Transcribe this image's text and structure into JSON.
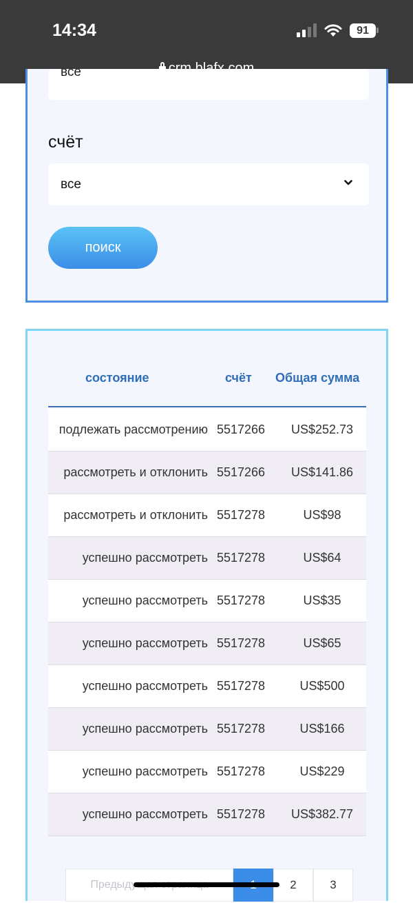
{
  "status_bar": {
    "time": "14:34",
    "battery": "91",
    "url": "crm.blafx.com"
  },
  "filter": {
    "prev_select_value": "все",
    "account_label": "счёт",
    "account_value": "все",
    "search_label": "поиск"
  },
  "table": {
    "headers": {
      "state": "состояние",
      "account": "счёт",
      "total": "Общая сумма"
    },
    "rows": [
      {
        "state": "подлежать рассмотрению",
        "account": "5517266",
        "total": "US$252.73"
      },
      {
        "state": "рассмотреть и отклонить",
        "account": "5517266",
        "total": "US$141.86"
      },
      {
        "state": "рассмотреть и отклонить",
        "account": "5517278",
        "total": "US$98"
      },
      {
        "state": "успешно рассмотреть",
        "account": "5517278",
        "total": "US$64"
      },
      {
        "state": "успешно рассмотреть",
        "account": "5517278",
        "total": "US$35"
      },
      {
        "state": "успешно рассмотреть",
        "account": "5517278",
        "total": "US$65"
      },
      {
        "state": "успешно рассмотреть",
        "account": "5517278",
        "total": "US$500"
      },
      {
        "state": "успешно рассмотреть",
        "account": "5517278",
        "total": "US$166"
      },
      {
        "state": "успешно рассмотреть",
        "account": "5517278",
        "total": "US$229"
      },
      {
        "state": "успешно рассмотреть",
        "account": "5517278",
        "total": "US$382.77"
      }
    ]
  },
  "pagination": {
    "prev_label": "Предыдущая страница",
    "pages": [
      "1",
      "2",
      "3"
    ],
    "current": "1"
  },
  "colors": {
    "accent": "#3b8de8",
    "header_text": "#2f6db8",
    "panel_bg": "#f3f6fd"
  }
}
